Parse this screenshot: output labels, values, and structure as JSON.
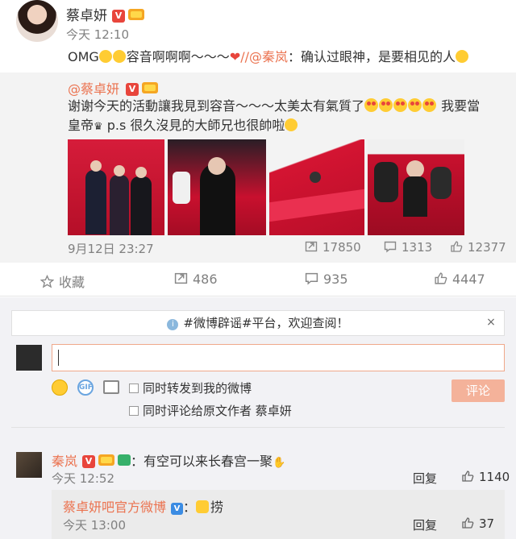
{
  "post": {
    "author": "蔡卓妍",
    "time": "今天 12:10",
    "text_prefix": "OMG",
    "text_main": "容音啊啊啊～～～",
    "text_mention": "//@秦岚",
    "text_suffix": "：确认过眼神，是要相见的人"
  },
  "quoted": {
    "author": "@蔡卓妍",
    "line1": "谢谢今天的活動讓我見到容音～～～太美太有氣質了",
    "line1_tail": "我要當",
    "line2": "皇帝",
    "line2_tail": "p.s 很久沒見的大師兄也很帥啦",
    "time": "9月12日 23:27",
    "reposts": "17850",
    "comments": "1313",
    "likes": "12377"
  },
  "actions": {
    "favorite": "收藏",
    "repost": "486",
    "comment": "935",
    "like": "4447"
  },
  "comment_box": {
    "notice": "#微博辟谣#平台，欢迎查阅！",
    "close": "×",
    "option1": "同时转发到我的微博",
    "option2": "同时评论给原文作者 蔡卓妍",
    "submit": "评论"
  },
  "comments": [
    {
      "author": "秦岚",
      "text": "：有空可以来长春宫一聚",
      "time": "今天 12:52",
      "reply": "回复",
      "likes": "1140"
    }
  ],
  "sub_comment": {
    "author": "蔡卓妍吧官方微博",
    "text": "捞",
    "time": "今天 13:00",
    "reply": "回复",
    "likes": "37"
  },
  "colors": {
    "accent": "#eb7350",
    "muted": "#808080",
    "quoted_bg": "#f3f3f3",
    "comment_bg": "#f2f2f5"
  },
  "icons": [
    "v-badge-icon",
    "crown-icon",
    "emoji-icon",
    "heart-icon",
    "repost-icon",
    "comment-icon",
    "like-icon",
    "star-icon",
    "info-icon",
    "close-icon",
    "smiley-icon",
    "gif-icon",
    "image-icon"
  ]
}
